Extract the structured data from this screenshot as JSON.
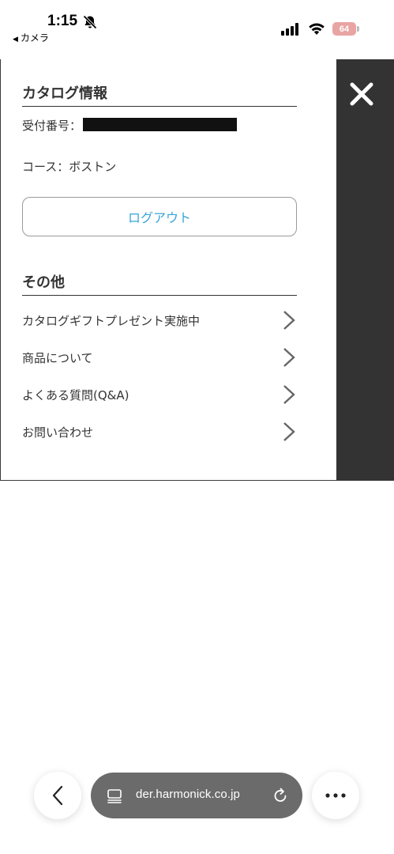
{
  "status_bar": {
    "time": "1:15",
    "back_app_label": "カメラ",
    "battery_level": "64"
  },
  "menu": {
    "catalog_section": {
      "heading": "カタログ情報",
      "receipt_label": "受付番号：",
      "course_text": "コース：ボストン",
      "logout_label": "ログアウト"
    },
    "other_section": {
      "heading": "その他",
      "items": [
        {
          "label": "カタログギフトプレゼント実施中"
        },
        {
          "label": "商品について"
        },
        {
          "label": "よくある質問(Q&A)"
        },
        {
          "label": "お問い合わせ"
        }
      ]
    }
  },
  "browser": {
    "url": "der.harmonick.co.jp"
  },
  "colors": {
    "accent_link": "#3aa4d9",
    "dark_strip": "#333333",
    "address_bar": "#6b6b6b",
    "battery": "#e9a4a4"
  }
}
